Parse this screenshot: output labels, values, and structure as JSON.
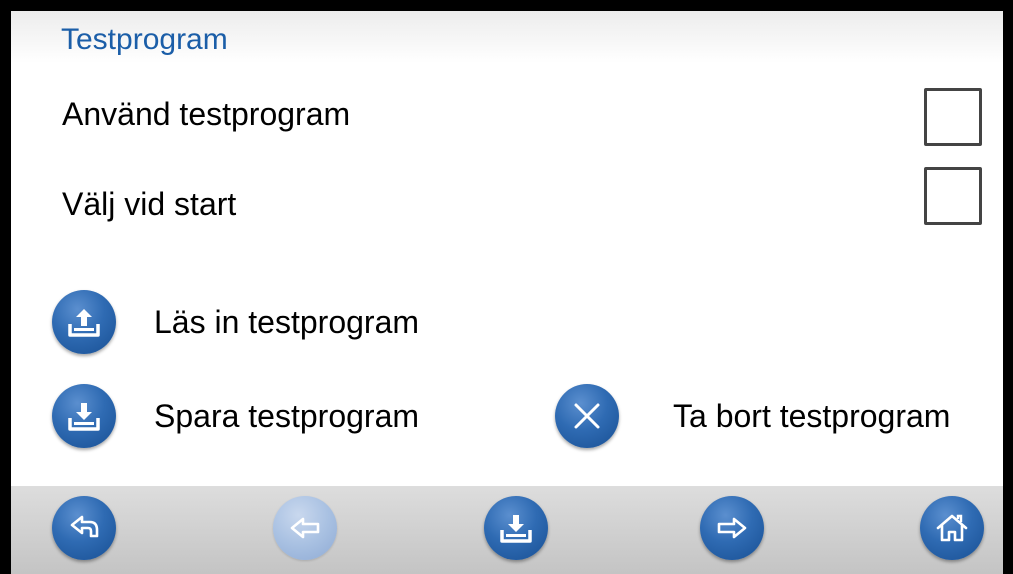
{
  "header": {
    "title": "Testprogram"
  },
  "settings": [
    {
      "label": "Använd testprogram",
      "checked": false
    },
    {
      "label": "Välj vid start",
      "checked": false
    }
  ],
  "actions": {
    "load_label": "Läs in testprogram",
    "save_label": "Spara testprogram",
    "delete_label": "Ta bort testprogram"
  },
  "nav": [
    {
      "icon": "back-return-icon",
      "enabled": true
    },
    {
      "icon": "arrow-left-icon",
      "enabled": false
    },
    {
      "icon": "save-download-icon",
      "enabled": true
    },
    {
      "icon": "arrow-right-icon",
      "enabled": true
    },
    {
      "icon": "home-icon",
      "enabled": true
    }
  ],
  "colors": {
    "title": "#1b5ea8",
    "button": "#2f6bb3",
    "button_disabled": "#a9c1e2"
  }
}
